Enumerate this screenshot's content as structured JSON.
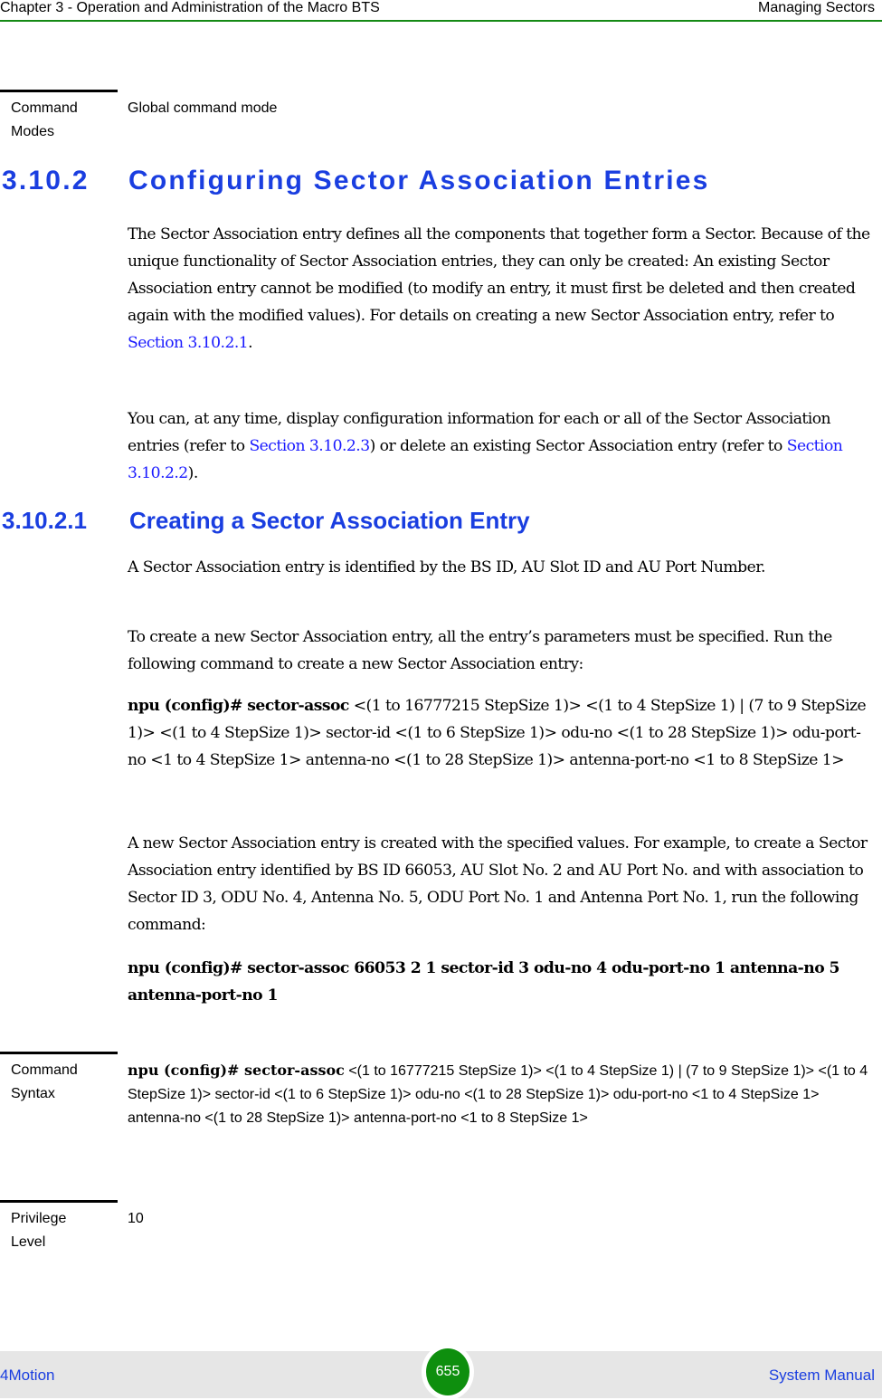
{
  "header": {
    "chapter": "Chapter 3 - Operation and Administration of the Macro BTS",
    "section": "Managing Sectors"
  },
  "command_modes": {
    "label_line1": "Command",
    "label_line2": "Modes",
    "value": "Global command mode"
  },
  "section": {
    "number": "3.10.2",
    "title": "Configuring Sector Association Entries",
    "para1": {
      "text": "The Sector Association entry defines all the components that together form a Sector. Because of the unique functionality of Sector Association entries, they can only be created: An existing Sector Association entry cannot be modified (to modify an entry, it must first be deleted and then created again with the modified values). For details on creating a new Sector Association entry, refer to ",
      "link": "Section 3.10.2.1",
      "tail": "."
    },
    "para2": {
      "text_a": "You can, at any time, display configuration information for each or all of the Sector Association entries (refer to ",
      "link_a": "Section 3.10.2.3",
      "text_b": ") or delete an existing Sector Association entry (refer to ",
      "link_b": "Section 3.10.2.2",
      "text_c": ")."
    }
  },
  "subsection": {
    "number": "3.10.2.1",
    "title": "Creating a Sector Association Entry",
    "para1": "A Sector Association entry is identified by the BS ID, AU Slot ID and AU Port Number.",
    "para2": "To create a new Sector Association entry, all the entry’s parameters must be specified. Run the following command to create a new Sector Association entry:",
    "command": {
      "bold": "npu (config)# sector-assoc",
      "args": " <(1 to 16777215 StepSize 1)> <(1 to 4 StepSize 1) | (7 to 9 StepSize 1)> <(1 to 4 StepSize 1)> sector-id <(1 to 6 StepSize 1)> odu-no <(1 to 28 StepSize 1)> odu-port-no <1 to 4 StepSize 1> antenna-no <(1 to 28 StepSize 1)> antenna-port-no <1 to 8 StepSize 1>"
    },
    "para3": "A new Sector Association entry is created with the specified values. For example, to create a Sector Association entry identified by BS ID 66053, AU Slot No. 2 and AU Port No. and with association to Sector ID 3, ODU No. 4, Antenna No. 5, ODU Port No. 1 and Antenna Port No. 1, run the following command:",
    "example": "npu (config)# sector-assoc 66053 2 1 sector-id 3 odu-no 4 odu-port-no 1 antenna-no 5 antenna-port-no 1"
  },
  "command_syntax": {
    "label_line1": "Command",
    "label_line2": "Syntax",
    "bold": "npu (config)# sector-assoc",
    "args": " <(1 to 16777215 StepSize 1)> <(1 to 4 StepSize 1) | (7 to 9 StepSize 1)> <(1 to 4 StepSize 1)> sector-id <(1 to 6 StepSize 1)> odu-no <(1 to 28 StepSize 1)> odu-port-no <1 to 4 StepSize 1> antenna-no <(1 to 28 StepSize 1)> antenna-port-no <1 to 8 StepSize 1>"
  },
  "privilege_level": {
    "label_line1": "Privilege",
    "label_line2": "Level",
    "value": "10"
  },
  "footer": {
    "product": "4Motion",
    "page_number": "655",
    "doc_type": "System Manual"
  }
}
